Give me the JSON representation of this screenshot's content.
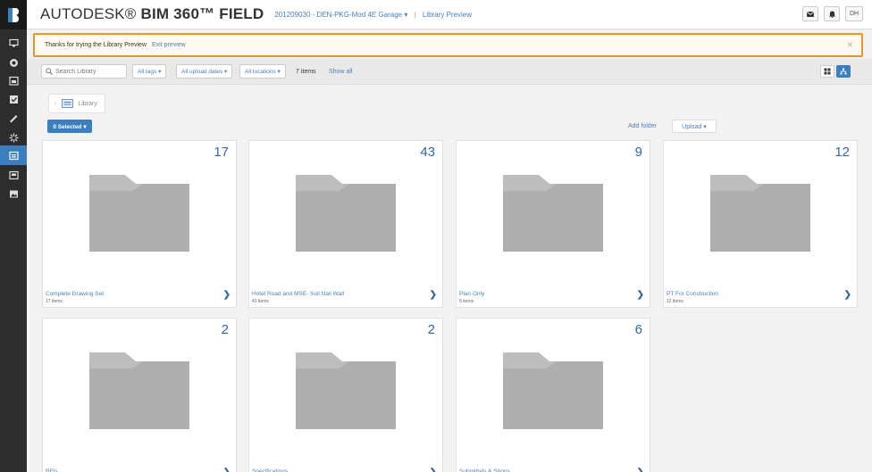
{
  "header": {
    "brand_main": "AUTODESK® ",
    "brand_bold": "BIM 360™ FIELD",
    "project": "201209030 - DEN-PKG-Mod 4E Garage",
    "project_caret": "▾",
    "section": "Library Preview",
    "avatar_initials": "DH"
  },
  "banner": {
    "message": "Thanks for trying the Library Preview",
    "exit_label": "Exit preview",
    "close_glyph": "×"
  },
  "toolbar": {
    "search_placeholder": "Search Library",
    "filters": [
      "All tags ▾",
      "All upload dates ▾",
      "All locations ▾"
    ],
    "count": "7 items",
    "show_all": "Show all"
  },
  "library": {
    "crumb_label": "Library",
    "selected_button": "0 Selected ▾",
    "add_folder": "Add folder",
    "upload": "Upload  ▾"
  },
  "folders": [
    {
      "name": "Complete Drawing Set",
      "count": "17",
      "items": "17 items"
    },
    {
      "name": "Hotel Road and MSE- Soil Nail Wall",
      "count": "43",
      "items": "43 items"
    },
    {
      "name": "Plan Only",
      "count": "9",
      "items": "9 items"
    },
    {
      "name": "PT For Construction",
      "count": "12",
      "items": "12 items"
    },
    {
      "name": "RFIs",
      "count": "2",
      "items": ""
    },
    {
      "name": "Specifications",
      "count": "2",
      "items": ""
    },
    {
      "name": "Submittals & Shops",
      "count": "6",
      "items": ""
    }
  ],
  "colors": {
    "accent": "#3b7fc1",
    "link": "#4a7fb8",
    "banner_border": "#e8962b",
    "rail": "#2d2d2d"
  }
}
